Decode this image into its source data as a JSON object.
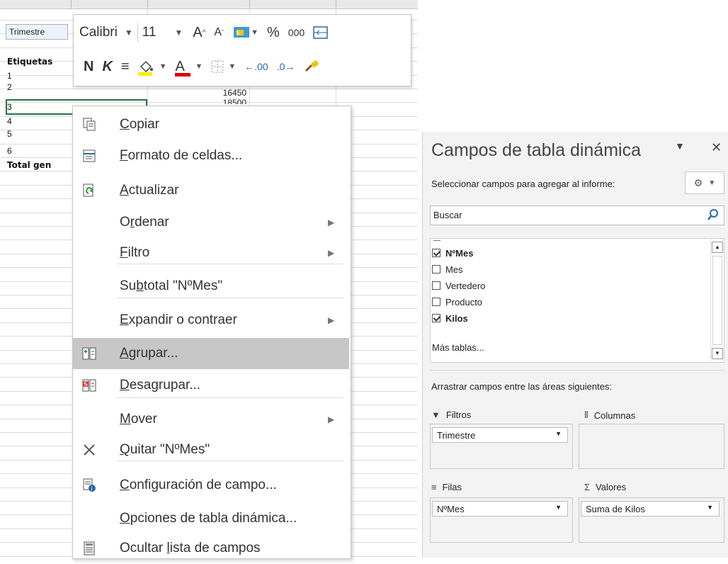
{
  "sheet": {
    "trimestre_filter": "Trimestre",
    "etiquetas_header": "Etiquetas",
    "row_labels": [
      "1",
      "2",
      "3",
      "4",
      "5",
      "6"
    ],
    "total_label": "Total gen",
    "values": {
      "row2": "16450",
      "row3_partial": "18500"
    }
  },
  "mini_toolbar": {
    "font_name": "Calibri",
    "font_size": "11",
    "grow_font": "A",
    "shrink_font": "A",
    "percent": "%",
    "thousands": "000",
    "bold": "N",
    "italic": "K",
    "align": "≡",
    "font_color_letter": "A",
    "dec_increase": ".00",
    "dec_decrease": ".0",
    "fill_color": "#ffee00",
    "font_color": "#e00000"
  },
  "context_menu": {
    "items": [
      {
        "label": "Copiar",
        "icon": "copy-icon",
        "arrow": false
      },
      {
        "label": "Formato de celdas...",
        "icon": "format-cells-icon",
        "arrow": false
      },
      {
        "label": "Actualizar",
        "icon": "refresh-icon",
        "arrow": false
      },
      {
        "label": "Ordenar",
        "icon": "",
        "arrow": true
      },
      {
        "label": "Filtro",
        "icon": "",
        "arrow": true
      },
      {
        "label": "Subtotal \"NºMes\"",
        "icon": "",
        "arrow": false
      },
      {
        "label": "Expandir o contraer",
        "icon": "",
        "arrow": true
      },
      {
        "label": "Agrupar...",
        "icon": "group-icon",
        "arrow": false,
        "highlighted": true
      },
      {
        "label": "Desagrupar...",
        "icon": "ungroup-icon",
        "arrow": false
      },
      {
        "label": "Mover",
        "icon": "",
        "arrow": true
      },
      {
        "label": "Quitar \"NºMes\"",
        "icon": "remove-x-icon",
        "arrow": false
      },
      {
        "label": "Configuración de campo...",
        "icon": "field-settings-icon",
        "arrow": false
      },
      {
        "label": "Opciones de tabla dinámica...",
        "icon": "",
        "arrow": false
      },
      {
        "label": "Ocultar lista de campos",
        "icon": "field-list-icon",
        "arrow": false
      }
    ]
  },
  "pivot_panel": {
    "title": "Campos de tabla dinámica",
    "subtitle": "Seleccionar campos para agregar al informe:",
    "search_placeholder": "Buscar",
    "fields": [
      {
        "name": "NºMes",
        "checked": true
      },
      {
        "name": "Mes",
        "checked": false
      },
      {
        "name": "Vertedero",
        "checked": false
      },
      {
        "name": "Producto",
        "checked": false
      },
      {
        "name": "Kilos",
        "checked": true
      }
    ],
    "more_tables": "Más tablas...",
    "drag_label": "Arrastrar campos entre las áreas siguientes:",
    "areas": {
      "filters": {
        "label": "Filtros",
        "item": "Trimestre"
      },
      "columns": {
        "label": "Columnas"
      },
      "rows": {
        "label": "Filas",
        "item": "NºMes"
      },
      "values": {
        "label": "Valores",
        "item": "Suma de Kilos"
      }
    }
  }
}
